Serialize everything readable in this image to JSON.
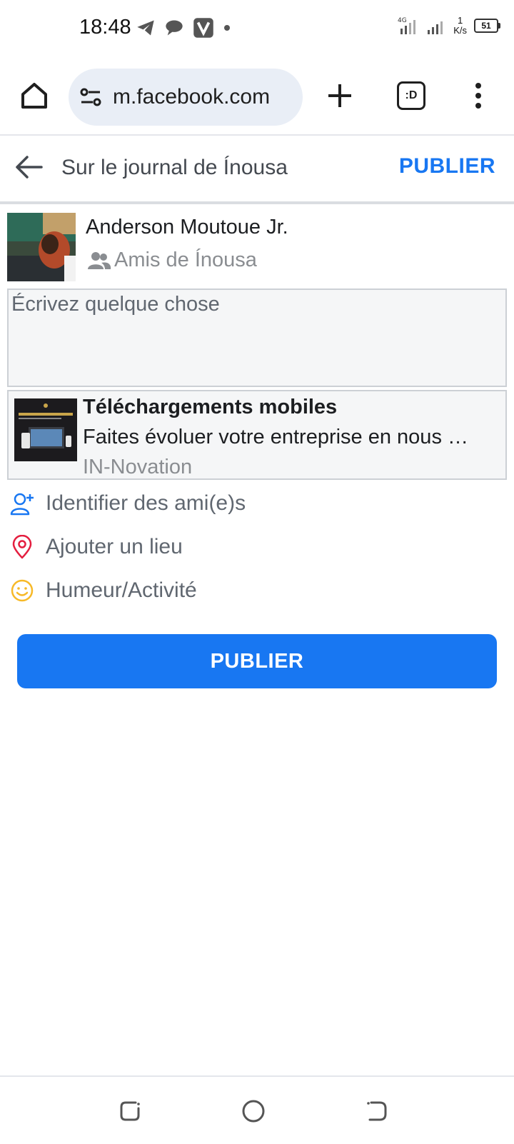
{
  "status_bar": {
    "time": "18:48",
    "net_speed_value": "1",
    "net_speed_unit": "K/s",
    "battery": "51",
    "network": "4G"
  },
  "browser": {
    "url": "m.facebook.com",
    "tab_count": ":D"
  },
  "header": {
    "title": "Sur le journal de Ínousa",
    "publish_label": "PUBLIER"
  },
  "author": {
    "name": "Anderson Moutoue Jr.",
    "audience": "Amis de Ínousa"
  },
  "composer": {
    "placeholder": "Écrivez quelque chose"
  },
  "link_preview": {
    "title": "Téléchargements mobiles",
    "description": "Faites évoluer votre entreprise en nous …",
    "source": "IN-Novation"
  },
  "actions": [
    {
      "label": "Identifier des ami(e)s",
      "icon": "tag-friend-icon",
      "color": "#1877f2"
    },
    {
      "label": "Ajouter un lieu",
      "icon": "location-pin-icon",
      "color": "#e41e3f"
    },
    {
      "label": "Humeur/Activité",
      "icon": "smiley-icon",
      "color": "#f7b928"
    }
  ],
  "publish_button": {
    "label": "PUBLIER"
  },
  "colors": {
    "accent": "#1877f2",
    "muted": "#606770",
    "border": "#ccd0d5"
  }
}
